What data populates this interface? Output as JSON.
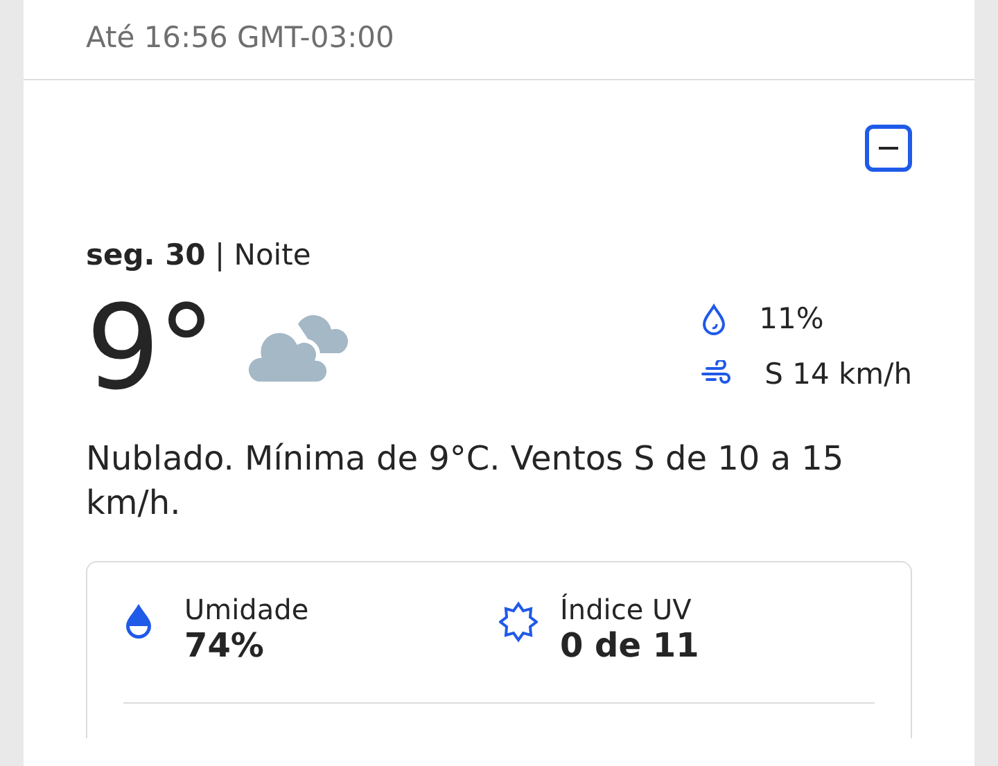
{
  "header": {
    "updated": "Até 16:56 GMT-03:00"
  },
  "period": {
    "expanded": true,
    "day": "seg. 30",
    "separator": "|",
    "part": "Noite",
    "temperature": "9°",
    "precipitation": "11%",
    "wind": "S 14 km/h",
    "narrative": "Nublado. Mínima de 9°C. Ventos S de 10 a 15 km/h."
  },
  "details": [
    {
      "kind": "humidity",
      "label": "Umidade",
      "value": "74%"
    },
    {
      "kind": "uv",
      "label": "Índice UV",
      "value": "0 de 11"
    }
  ]
}
